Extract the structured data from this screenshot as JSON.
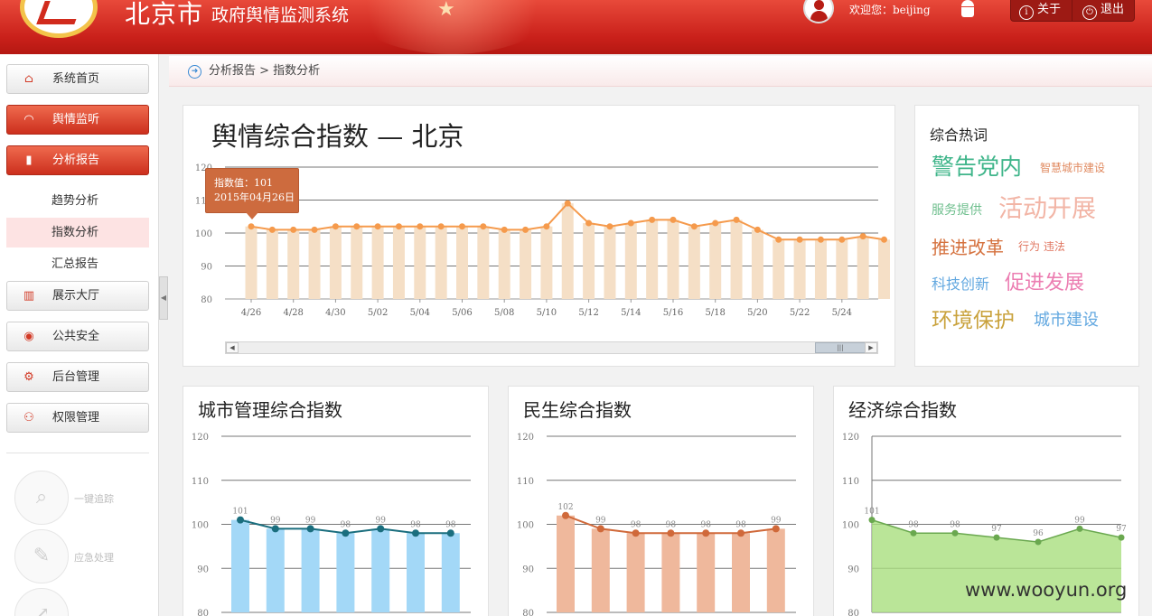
{
  "header": {
    "city": "北京市",
    "system_name": "政府舆情监测系统",
    "welcome": "欢迎您：beijing",
    "about_label": "关于",
    "logout_label": "退出",
    "colors": {
      "primary": "#c9201a"
    }
  },
  "sidebar": {
    "items": [
      {
        "label": "系统首页",
        "icon": "home-icon",
        "state": "normal"
      },
      {
        "label": "舆情监听",
        "icon": "headphones-icon",
        "state": "highlighted"
      },
      {
        "label": "分析报告",
        "icon": "bar-chart-icon",
        "state": "selected"
      },
      {
        "label": "展示大厅",
        "icon": "building-icon",
        "state": "normal"
      },
      {
        "label": "公共安全",
        "icon": "alarm-icon",
        "state": "normal"
      },
      {
        "label": "后台管理",
        "icon": "gear-icon",
        "state": "normal"
      },
      {
        "label": "权限管理",
        "icon": "users-icon",
        "state": "normal"
      }
    ],
    "sub_items": [
      {
        "label": "趋势分析",
        "active": false
      },
      {
        "label": "指数分析",
        "active": true
      },
      {
        "label": "汇总报告",
        "active": false
      }
    ],
    "quick_actions": [
      {
        "label": "一键追踪",
        "icon": "magnifier-icon"
      },
      {
        "label": "应急处理",
        "icon": "edit-icon"
      },
      {
        "label": "",
        "icon": "analysis-icon"
      }
    ]
  },
  "breadcrumb": "分析报告 > 指数分析",
  "main_chart": {
    "title": "舆情综合指数 — 北京",
    "tooltip": {
      "line1": "指数值：101",
      "line2": "2015年04月26日"
    }
  },
  "hot_words": {
    "title": "综合热词",
    "words": [
      {
        "text": "警告党内",
        "color": "#3fb58a"
      },
      {
        "text": "智慧城市建设",
        "color": "#e08a60"
      },
      {
        "text": "服务提供",
        "color": "#6fbf8e"
      },
      {
        "text": "活动开展",
        "color": "#f2b5a6"
      },
      {
        "text": "推进改革",
        "color": "#d5723f"
      },
      {
        "text": "行为 违法",
        "color": "#e07660"
      },
      {
        "text": "科技创新",
        "color": "#63a8e0"
      },
      {
        "text": "促进发展",
        "color": "#ec7eb2"
      },
      {
        "text": "环境保护",
        "color": "#c9a23c"
      },
      {
        "text": "城市建设",
        "color": "#63a8e0"
      }
    ]
  },
  "charts": {
    "city": {
      "title": "城市管理综合指数"
    },
    "livelihood": {
      "title": "民生综合指数"
    },
    "economy": {
      "title": "经济综合指数"
    }
  },
  "watermark": "www.wooyun.org",
  "chart_data": [
    {
      "type": "bar",
      "title": "舆情综合指数 — 北京",
      "y_ticks": [
        80,
        90,
        100,
        110,
        120
      ],
      "ylim": [
        80,
        120
      ],
      "x_tick_labels": [
        "4/26",
        "4/28",
        "4/30",
        "5/02",
        "5/04",
        "5/06",
        "5/08",
        "5/10",
        "5/12",
        "5/14",
        "5/16",
        "5/18",
        "5/20",
        "5/22",
        "5/24"
      ],
      "values": [
        102,
        101,
        101,
        101,
        102,
        102,
        102,
        102,
        102,
        102,
        102,
        102,
        101,
        101,
        102,
        109,
        103,
        102,
        103,
        104,
        104,
        102,
        103,
        104,
        101,
        98,
        98,
        98,
        98,
        99,
        98
      ],
      "line_values": [
        102,
        101,
        101,
        101,
        102,
        102,
        102,
        102,
        102,
        102,
        102,
        102,
        101,
        101,
        102,
        109,
        103,
        102,
        103,
        104,
        104,
        102,
        103,
        104,
        101,
        98,
        98,
        98,
        98,
        99,
        98
      ],
      "colors": {
        "bar": "#f5dfc6",
        "line": "#f59a4c"
      }
    },
    {
      "type": "bar",
      "title": "城市管理综合指数",
      "y_ticks": [
        80,
        90,
        100,
        110,
        120
      ],
      "ylim": [
        80,
        120
      ],
      "values": [
        101,
        99,
        99,
        98,
        99,
        98,
        98
      ],
      "colors": {
        "bar": "#a3d8f7",
        "line": "#1a6e7e"
      }
    },
    {
      "type": "bar",
      "title": "民生综合指数",
      "y_ticks": [
        80,
        90,
        100,
        110,
        120
      ],
      "ylim": [
        80,
        120
      ],
      "values": [
        102,
        99,
        98,
        98,
        98,
        98,
        99
      ],
      "colors": {
        "bar": "#efb89c",
        "line": "#d0693a"
      }
    },
    {
      "type": "area",
      "title": "经济综合指数",
      "y_ticks": [
        80,
        90,
        100,
        110,
        120
      ],
      "ylim": [
        80,
        120
      ],
      "values": [
        101,
        98,
        98,
        97,
        96,
        99,
        97
      ],
      "colors": {
        "fill": "#a9de7e",
        "line": "#6aa84f"
      }
    }
  ]
}
